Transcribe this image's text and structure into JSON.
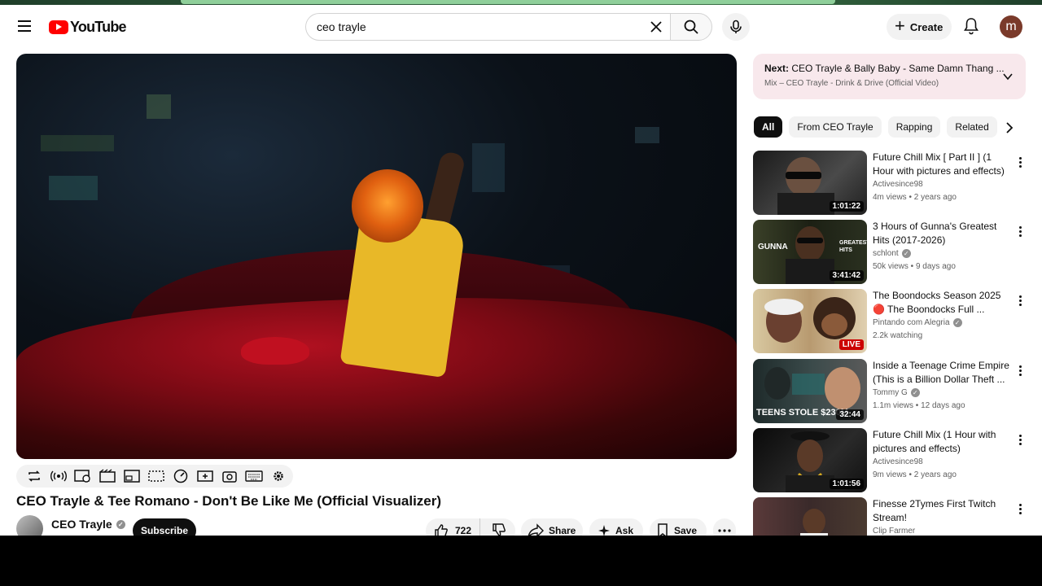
{
  "header": {
    "logo_text": "YouTube",
    "search_value": "ceo trayle",
    "create_label": "Create",
    "avatar_letter": "m"
  },
  "video": {
    "title": "CEO Trayle & Tee Romano - Don't Be Like Me (Official Visualizer)",
    "channel": "CEO Trayle",
    "subscribe_label": "Subscribe",
    "likes": "722",
    "share_label": "Share",
    "ask_label": "Ask",
    "save_label": "Save"
  },
  "up_next": {
    "prefix": "Next:",
    "title": "CEO Trayle & Bally Baby - Same Damn Thang ...",
    "subtitle": "Mix – CEO Trayle - Drink & Drive (Official Video)"
  },
  "chips": [
    "All",
    "From CEO Trayle",
    "Rapping",
    "Related"
  ],
  "recommendations": [
    {
      "title": "Future Chill Mix [ Part II ] (1 Hour with pictures and effects)",
      "channel": "Activesince98",
      "verified": false,
      "meta": "4m views • 2 years ago",
      "duration": "1:01:22",
      "thumb_color": "#2a2a2a"
    },
    {
      "title": "3 Hours of Gunna's Greatest Hits (2017-2026)",
      "channel": "schlont",
      "verified": true,
      "meta": "50k views • 9 days ago",
      "duration": "3:41:42",
      "thumb_color": "#2e3320",
      "thumb_text_left": "GUNNA",
      "thumb_text_right": "GREATEST HITS"
    },
    {
      "title": "The Boondocks Season 2025 🔴 The Boondocks Full ...",
      "channel": "Pintando com Alegria",
      "verified": true,
      "meta": "2.2k watching",
      "live": "LIVE",
      "thumb_color": "#c9b48a"
    },
    {
      "title": "Inside a Teenage Crime Empire (This is a Billion Dollar Theft ...",
      "channel": "Tommy G",
      "verified": true,
      "meta": "1.1m views • 12 days ago",
      "duration": "32:44",
      "thumb_color": "#3a4a4a",
      "thumb_text": "TEENS STOLE $230M"
    },
    {
      "title": "Future Chill Mix (1 Hour with pictures and effects)",
      "channel": "Activesince98",
      "verified": false,
      "meta": "9m views • 2 years ago",
      "duration": "1:01:56",
      "thumb_color": "#1a1a1a"
    },
    {
      "title": "Finesse 2Tymes First Twitch Stream!",
      "channel": "Clip Farmer",
      "verified": false,
      "meta": "",
      "thumb_color": "#4a3a3a"
    }
  ],
  "colors": {
    "accent": "#ff0000",
    "live": "#cc0000",
    "up_next_bg": "#f8e8ec"
  }
}
